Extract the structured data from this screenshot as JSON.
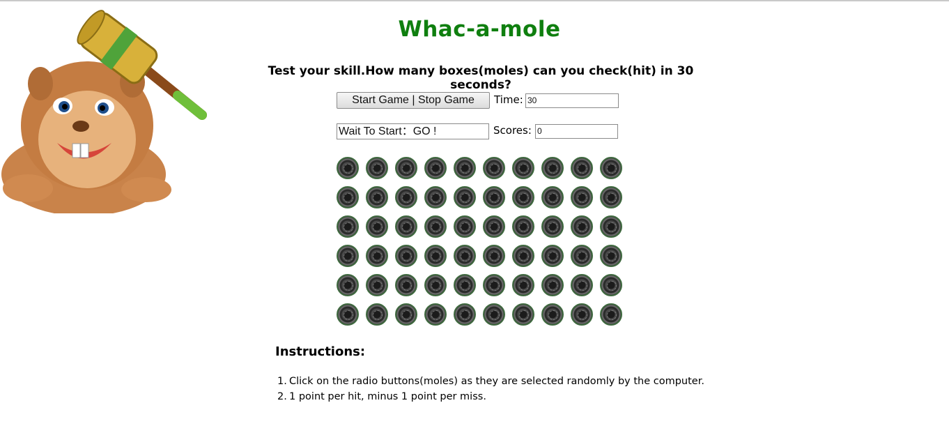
{
  "header": {
    "title": "Whac-a-mole",
    "subtitle": "Test your skill.How many boxes(moles) can you check(hit) in 30 seconds?"
  },
  "controls": {
    "game_button_label": "Start Game | Stop Game",
    "time_label": "Time:",
    "time_value": "30",
    "status_value": "Wait To Start：GO !",
    "scores_label": "Scores:",
    "scores_value": "0"
  },
  "board": {
    "rows": 6,
    "columns": 10,
    "hole_icon": "mole-hole-icon"
  },
  "instructions": {
    "title": "Instructions:",
    "items": [
      {
        "number": "1.",
        "text": "Click on the radio buttons(moles) as they are selected randomly by the computer."
      },
      {
        "number": "2.",
        "text": "1 point per hit, minus 1 point per miss."
      }
    ]
  },
  "colors": {
    "title_green": "#0f7f0f",
    "hole_ring": "#3f6a3f"
  }
}
